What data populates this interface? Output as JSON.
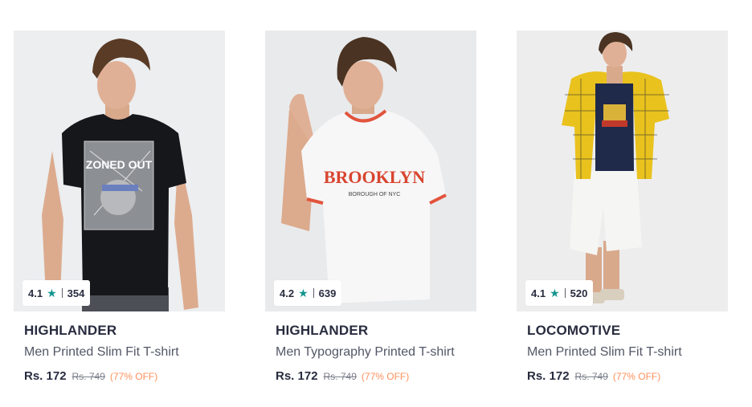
{
  "colors": {
    "star": "#14958f",
    "discount": "#ff905a",
    "brand_text": "#282c3f",
    "title_text": "#535766"
  },
  "products": [
    {
      "brand": "HIGHLANDER",
      "title": "Men Printed Slim Fit T-shirt",
      "price": "Rs. 172",
      "mrp": "Rs. 749",
      "discount": "(77% OFF)",
      "rating": "4.1",
      "rating_count": "354",
      "print_text": "ZONED OUT",
      "tshirt_color": "black"
    },
    {
      "brand": "HIGHLANDER",
      "title": "Men Typography Printed T-shirt",
      "price": "Rs. 172",
      "mrp": "Rs. 749",
      "discount": "(77% OFF)",
      "rating": "4.2",
      "rating_count": "639",
      "print_text": "BROOKLYN",
      "print_subtext": "BOROUGH OF NYC",
      "tshirt_color": "white"
    },
    {
      "brand": "LOCOMOTIVE",
      "title": "Men Printed Slim Fit T-shirt",
      "price": "Rs. 172",
      "mrp": "Rs. 749",
      "discount": "(77% OFF)",
      "rating": "4.1",
      "rating_count": "520",
      "tshirt_color": "navy"
    }
  ]
}
